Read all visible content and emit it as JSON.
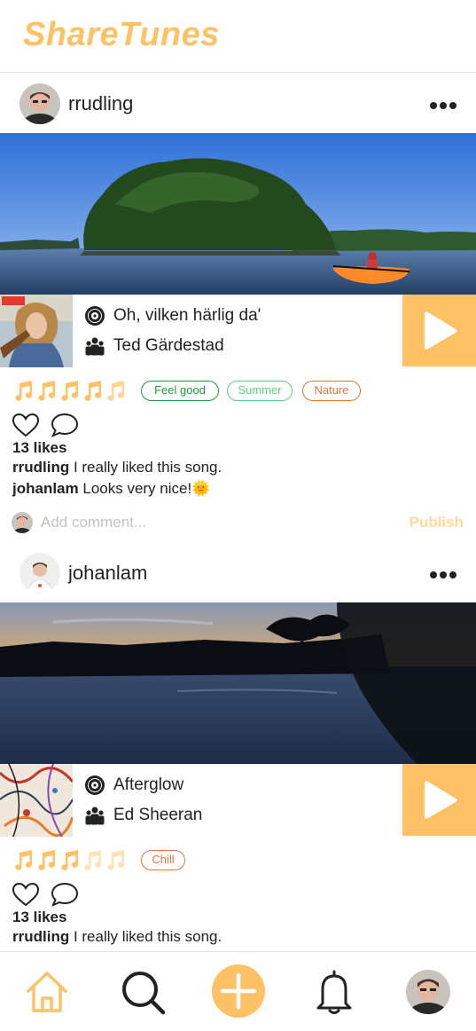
{
  "app": {
    "title": "ShareTunes"
  },
  "colors": {
    "accent": "#ffc166",
    "tag_green": "#1f9a3a",
    "tag_lightgreen": "#5ccf7a",
    "tag_orange": "#e0763a"
  },
  "posts": [
    {
      "username": "rrudling",
      "song_title": "Oh, vilken härlig da'",
      "artist": "Ted Gärdestad",
      "rating": 4.5,
      "rating_max": 5,
      "tags": [
        "Feel good",
        "Summer",
        "Nature"
      ],
      "likes": "13 likes",
      "comments": [
        {
          "user": "rrudling",
          "text": "I really liked this song."
        },
        {
          "user": "johanlam",
          "text": "Looks very nice!🌞"
        }
      ],
      "comment_placeholder": "Add comment...",
      "publish_label": "Publish"
    },
    {
      "username": "johanlam",
      "song_title": "Afterglow",
      "artist": "Ed Sheeran",
      "rating": 3,
      "rating_max": 5,
      "tags": [
        "Chill"
      ],
      "likes": "13 likes",
      "comments": [
        {
          "user": "rrudling",
          "text": "I really liked this song."
        }
      ]
    }
  ],
  "nav": {
    "icons": [
      "home-icon",
      "search-icon",
      "add-icon",
      "bell-icon",
      "profile-avatar"
    ]
  }
}
